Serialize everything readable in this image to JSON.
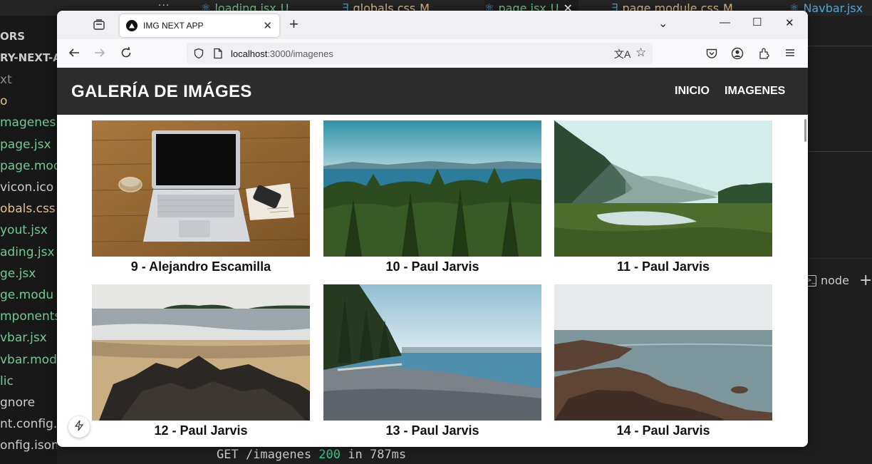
{
  "vscode": {
    "tabs": [
      {
        "label": "loading.jsx",
        "status": "U",
        "icon": "react-icon",
        "color": "#4fa6d6"
      },
      {
        "label": "globals.css",
        "status": "M",
        "icon": "css-icon",
        "color": "#519aba"
      },
      {
        "label": "page.jsx",
        "status": "U",
        "icon": "react-icon",
        "color": "#4fa6d6"
      },
      {
        "label": "page.module.css",
        "status": "M",
        "icon": "css-icon",
        "color": "#519aba"
      },
      {
        "label": "Navbar.jsx",
        "status": "",
        "icon": "react-icon",
        "color": "#4fa6d6"
      }
    ],
    "explorer_title": "ORS",
    "project_name": "RY-NEXT-A",
    "files": [
      {
        "label": "xt",
        "color": "#8b8b8b"
      },
      {
        "label": "o",
        "color": "#e2c08d"
      },
      {
        "label": "magenes",
        "color": "#73c991"
      },
      {
        "label": "page.jsx",
        "color": "#73c991"
      },
      {
        "label": "page.mod",
        "color": "#73c991"
      },
      {
        "label": "vicon.ico",
        "color": "#cccccc"
      },
      {
        "label": "obals.css",
        "color": "#e2c08d"
      },
      {
        "label": "yout.jsx",
        "color": "#73c991"
      },
      {
        "label": "ading.jsx",
        "color": "#73c991"
      },
      {
        "label": "ge.jsx",
        "color": "#73c991"
      },
      {
        "label": "ge.modu",
        "color": "#73c991"
      },
      {
        "label": "mponents",
        "color": "#73c991"
      },
      {
        "label": "vbar.jsx",
        "color": "#73c991"
      },
      {
        "label": "vbar.mod",
        "color": "#73c991"
      },
      {
        "label": "lic",
        "color": "#73c991"
      },
      {
        "label": "gnore",
        "color": "#cccccc"
      },
      {
        "label": "nt.config.",
        "color": "#cccccc"
      },
      {
        "label": "onfig.ison",
        "color": "#cccccc"
      }
    ],
    "terminal_tab": "node",
    "terminal_line": {
      "method": "GET /imagenes ",
      "code": "200",
      "rest": " in 787ms"
    }
  },
  "browser": {
    "tab_title": "IMG NEXT APP",
    "url_host": "localhost",
    "url_rest": ":3000/imagenes"
  },
  "site": {
    "title": "GALERÍA DE IMÁGES",
    "nav": [
      "INICIO",
      "IMAGENES"
    ]
  },
  "gallery": [
    {
      "caption": "9 - Alejandro Escamilla",
      "scene": "laptop"
    },
    {
      "caption": "10 - Paul Jarvis",
      "scene": "forest-sea"
    },
    {
      "caption": "11 - Paul Jarvis",
      "scene": "valley"
    },
    {
      "caption": "12 - Paul Jarvis",
      "scene": "beach-rocks"
    },
    {
      "caption": "13 - Paul Jarvis",
      "scene": "pebble-shore"
    },
    {
      "caption": "14 - Paul Jarvis",
      "scene": "rocky-coast"
    }
  ]
}
